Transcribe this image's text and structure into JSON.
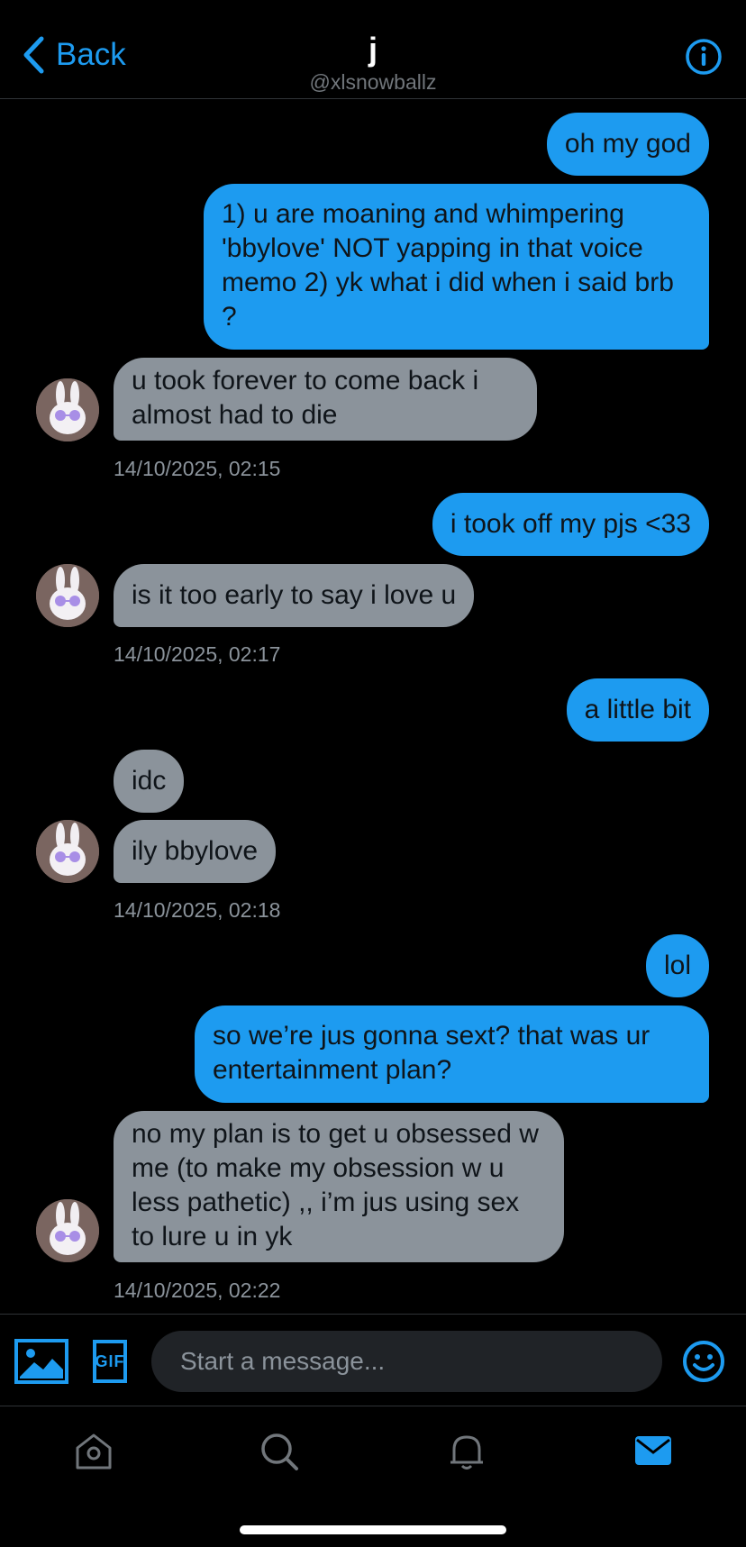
{
  "header": {
    "back_label": "Back",
    "title": "j",
    "handle": "@xlsnowballz"
  },
  "messages": [
    {
      "from": "me",
      "text": "oh my god"
    },
    {
      "from": "me",
      "text": "1) u are moaning and whimpering 'bbylove' NOT yapping in that voice memo 2) yk what i did when i said brb ?"
    },
    {
      "from": "them",
      "text": "u took forever to come back i almost had to die"
    },
    {
      "timestamp": "14/10/2025, 02:15"
    },
    {
      "from": "me",
      "text": "i took off my pjs <33"
    },
    {
      "from": "them",
      "text": "is it too early to say i love u"
    },
    {
      "timestamp": "14/10/2025, 02:17"
    },
    {
      "from": "me",
      "text": "a little bit"
    },
    {
      "from": "them",
      "text": "idc"
    },
    {
      "from": "them",
      "text": "ily bbylove"
    },
    {
      "timestamp": "14/10/2025, 02:18"
    },
    {
      "from": "me",
      "text": "lol"
    },
    {
      "from": "me",
      "text": "so we’re jus gonna sext? that was ur entertainment plan?"
    },
    {
      "from": "them",
      "text": "no my plan is to get u obsessed w me (to make my obsession w u less pathetic) ,, i’m jus using sex to lure u in yk"
    },
    {
      "timestamp": "14/10/2025, 02:22"
    }
  ],
  "composer": {
    "placeholder": "Start a message...",
    "gif_label": "GIF"
  },
  "icons": {
    "accent": "#1d9bf0",
    "incoming_bubble": "#8b939b",
    "names": [
      "chevron-left-icon",
      "info-icon",
      "image-icon",
      "gif-icon",
      "emoji-icon",
      "home-icon",
      "search-icon",
      "bell-icon",
      "mail-icon"
    ]
  }
}
